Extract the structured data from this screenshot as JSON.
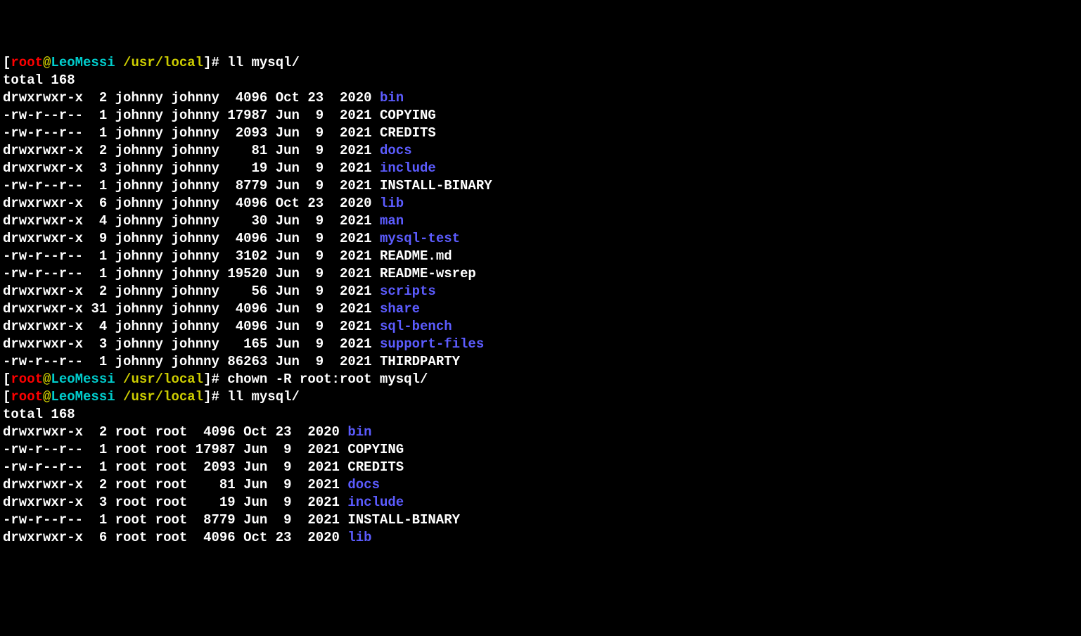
{
  "prompts": [
    {
      "user": "root",
      "at": "@",
      "host": "LeoMessi",
      "path": "/usr/local",
      "command": "ll mysql/"
    },
    {
      "user": "root",
      "at": "@",
      "host": "LeoMessi",
      "path": "/usr/local",
      "command": "chown -R root:root mysql/"
    },
    {
      "user": "root",
      "at": "@",
      "host": "LeoMessi",
      "path": "/usr/local",
      "command": "ll mysql/"
    }
  ],
  "listings": [
    {
      "total": "total 168",
      "rows": [
        {
          "perm": "drwxrwxr-x",
          "links": "2",
          "user": "johnny",
          "group": "johnny",
          "size": "4096",
          "month": "Oct",
          "day": "23",
          "yeartime": "2020",
          "name": "bin",
          "dir": true
        },
        {
          "perm": "-rw-r--r--",
          "links": "1",
          "user": "johnny",
          "group": "johnny",
          "size": "17987",
          "month": "Jun",
          "day": "9",
          "yeartime": "2021",
          "name": "COPYING",
          "dir": false
        },
        {
          "perm": "-rw-r--r--",
          "links": "1",
          "user": "johnny",
          "group": "johnny",
          "size": "2093",
          "month": "Jun",
          "day": "9",
          "yeartime": "2021",
          "name": "CREDITS",
          "dir": false
        },
        {
          "perm": "drwxrwxr-x",
          "links": "2",
          "user": "johnny",
          "group": "johnny",
          "size": "81",
          "month": "Jun",
          "day": "9",
          "yeartime": "2021",
          "name": "docs",
          "dir": true
        },
        {
          "perm": "drwxrwxr-x",
          "links": "3",
          "user": "johnny",
          "group": "johnny",
          "size": "19",
          "month": "Jun",
          "day": "9",
          "yeartime": "2021",
          "name": "include",
          "dir": true
        },
        {
          "perm": "-rw-r--r--",
          "links": "1",
          "user": "johnny",
          "group": "johnny",
          "size": "8779",
          "month": "Jun",
          "day": "9",
          "yeartime": "2021",
          "name": "INSTALL-BINARY",
          "dir": false
        },
        {
          "perm": "drwxrwxr-x",
          "links": "6",
          "user": "johnny",
          "group": "johnny",
          "size": "4096",
          "month": "Oct",
          "day": "23",
          "yeartime": "2020",
          "name": "lib",
          "dir": true
        },
        {
          "perm": "drwxrwxr-x",
          "links": "4",
          "user": "johnny",
          "group": "johnny",
          "size": "30",
          "month": "Jun",
          "day": "9",
          "yeartime": "2021",
          "name": "man",
          "dir": true
        },
        {
          "perm": "drwxrwxr-x",
          "links": "9",
          "user": "johnny",
          "group": "johnny",
          "size": "4096",
          "month": "Jun",
          "day": "9",
          "yeartime": "2021",
          "name": "mysql-test",
          "dir": true
        },
        {
          "perm": "-rw-r--r--",
          "links": "1",
          "user": "johnny",
          "group": "johnny",
          "size": "3102",
          "month": "Jun",
          "day": "9",
          "yeartime": "2021",
          "name": "README.md",
          "dir": false
        },
        {
          "perm": "-rw-r--r--",
          "links": "1",
          "user": "johnny",
          "group": "johnny",
          "size": "19520",
          "month": "Jun",
          "day": "9",
          "yeartime": "2021",
          "name": "README-wsrep",
          "dir": false
        },
        {
          "perm": "drwxrwxr-x",
          "links": "2",
          "user": "johnny",
          "group": "johnny",
          "size": "56",
          "month": "Jun",
          "day": "9",
          "yeartime": "2021",
          "name": "scripts",
          "dir": true
        },
        {
          "perm": "drwxrwxr-x",
          "links": "31",
          "user": "johnny",
          "group": "johnny",
          "size": "4096",
          "month": "Jun",
          "day": "9",
          "yeartime": "2021",
          "name": "share",
          "dir": true
        },
        {
          "perm": "drwxrwxr-x",
          "links": "4",
          "user": "johnny",
          "group": "johnny",
          "size": "4096",
          "month": "Jun",
          "day": "9",
          "yeartime": "2021",
          "name": "sql-bench",
          "dir": true
        },
        {
          "perm": "drwxrwxr-x",
          "links": "3",
          "user": "johnny",
          "group": "johnny",
          "size": "165",
          "month": "Jun",
          "day": "9",
          "yeartime": "2021",
          "name": "support-files",
          "dir": true
        },
        {
          "perm": "-rw-r--r--",
          "links": "1",
          "user": "johnny",
          "group": "johnny",
          "size": "86263",
          "month": "Jun",
          "day": "9",
          "yeartime": "2021",
          "name": "THIRDPARTY",
          "dir": false
        }
      ]
    },
    {
      "total": "total 168",
      "rows": [
        {
          "perm": "drwxrwxr-x",
          "links": "2",
          "user": "root",
          "group": "root",
          "size": "4096",
          "month": "Oct",
          "day": "23",
          "yeartime": "2020",
          "name": "bin",
          "dir": true
        },
        {
          "perm": "-rw-r--r--",
          "links": "1",
          "user": "root",
          "group": "root",
          "size": "17987",
          "month": "Jun",
          "day": "9",
          "yeartime": "2021",
          "name": "COPYING",
          "dir": false
        },
        {
          "perm": "-rw-r--r--",
          "links": "1",
          "user": "root",
          "group": "root",
          "size": "2093",
          "month": "Jun",
          "day": "9",
          "yeartime": "2021",
          "name": "CREDITS",
          "dir": false
        },
        {
          "perm": "drwxrwxr-x",
          "links": "2",
          "user": "root",
          "group": "root",
          "size": "81",
          "month": "Jun",
          "day": "9",
          "yeartime": "2021",
          "name": "docs",
          "dir": true
        },
        {
          "perm": "drwxrwxr-x",
          "links": "3",
          "user": "root",
          "group": "root",
          "size": "19",
          "month": "Jun",
          "day": "9",
          "yeartime": "2021",
          "name": "include",
          "dir": true
        },
        {
          "perm": "-rw-r--r--",
          "links": "1",
          "user": "root",
          "group": "root",
          "size": "8779",
          "month": "Jun",
          "day": "9",
          "yeartime": "2021",
          "name": "INSTALL-BINARY",
          "dir": false
        },
        {
          "perm": "drwxrwxr-x",
          "links": "6",
          "user": "root",
          "group": "root",
          "size": "4096",
          "month": "Oct",
          "day": "23",
          "yeartime": "2020",
          "name": "lib",
          "dir": true
        }
      ]
    }
  ]
}
